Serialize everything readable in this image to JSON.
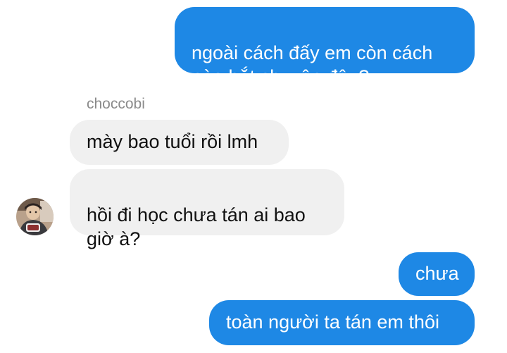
{
  "conversation": {
    "messages": [
      {
        "side": "out",
        "text": "ngoài cách đấy em còn cách\nnào bắt chuyện đâu?"
      },
      {
        "side": "in",
        "text": "mày bao tuổi rồi lmh"
      },
      {
        "side": "in",
        "text": "hồi đi học chưa tán ai bao\ngiờ à?"
      },
      {
        "side": "out",
        "text": "chưa"
      },
      {
        "side": "out",
        "text": "toàn người ta tán em thôi"
      }
    ],
    "sender_name": "choccobi"
  },
  "colors": {
    "outgoing_bubble": "#1e88e5",
    "incoming_bubble": "#f0f0f0",
    "sender_name": "#8a8a8a"
  },
  "icons": {
    "avatar": "user-avatar-photo"
  }
}
